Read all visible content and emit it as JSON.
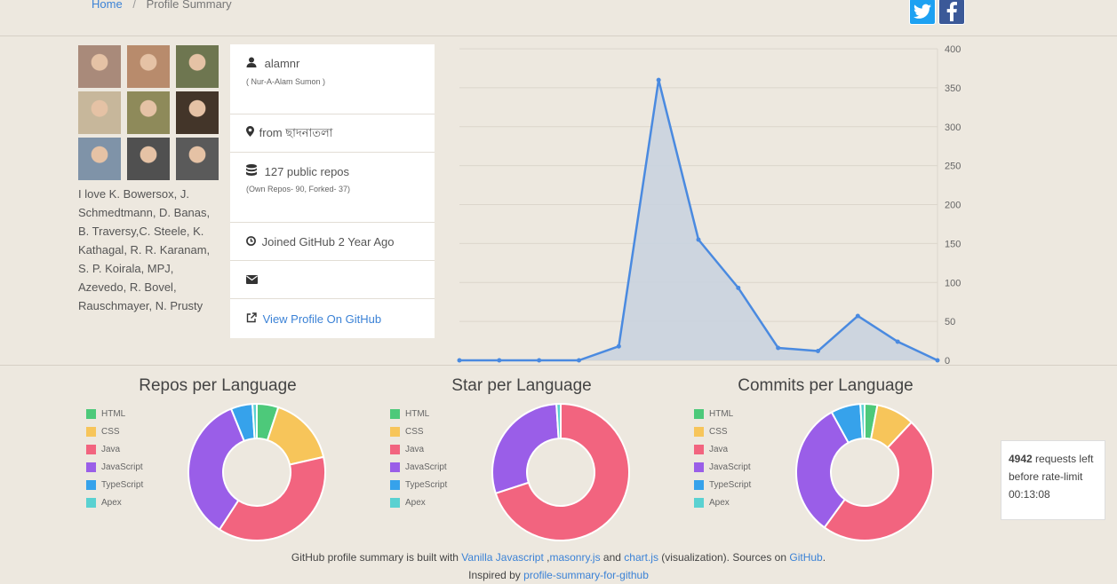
{
  "breadcrumb": {
    "home": "Home",
    "sep": "/",
    "current": "Profile Summary"
  },
  "social": {
    "twitter_glyph": "t",
    "facebook_glyph": "f",
    "twitter_color": "#1da1f2",
    "facebook_color": "#3b5998"
  },
  "avatars": [
    {
      "name": "avatar-1",
      "color": "#a98a7a"
    },
    {
      "name": "avatar-2",
      "color": "#b88b6c"
    },
    {
      "name": "avatar-3",
      "color": "#6e7650"
    },
    {
      "name": "avatar-4",
      "color": "#c7b79b"
    },
    {
      "name": "avatar-5",
      "color": "#8e8a5a"
    },
    {
      "name": "avatar-6",
      "color": "#433529"
    },
    {
      "name": "avatar-7",
      "color": "#7f93a8"
    },
    {
      "name": "avatar-8",
      "color": "#505050"
    },
    {
      "name": "avatar-9",
      "color": "#5a5a5a"
    }
  ],
  "love_text": "I love K. Bowersox, J. Schmedtmann, D. Banas, B. Traversy,C. Steele, K. Kathagal, R. R. Karanam, S. P. Koirala, MPJ, Azevedo, R. Bovel, Rauschmayer, N. Prusty",
  "profile": {
    "username": "alamnr",
    "fullname": "( Nur-A-Alam Sumon )",
    "location": "from ছাদনাতলা",
    "repos": "127 public repos",
    "repos_detail": "(Own Repos- 90, Forked- 37)",
    "joined": "Joined GitHub 2 Year Ago",
    "view_profile": "View Profile On GitHub"
  },
  "chart_data": [
    {
      "type": "area",
      "x": [
        1,
        2,
        3,
        4,
        5,
        6,
        7,
        8,
        9,
        10,
        11,
        12,
        13
      ],
      "values": [
        0,
        0,
        0,
        0,
        18,
        360,
        155,
        93,
        16,
        12,
        57,
        24,
        0
      ],
      "yticks": [
        "400",
        "350",
        "300",
        "250",
        "200",
        "150",
        "100",
        "50",
        "0"
      ],
      "ylim": [
        0,
        400
      ],
      "grid": true,
      "color": "#4a8ae0",
      "fill": "#c9d3df"
    },
    {
      "type": "pie",
      "title": "Repos per Language",
      "labels": [
        "HTML",
        "CSS",
        "Java",
        "JavaScript",
        "TypeScript",
        "Apex"
      ],
      "values": [
        5,
        16,
        37,
        34,
        5,
        1
      ],
      "colors": [
        "#4dc97a",
        "#f7c55a",
        "#f2647f",
        "#9a5ee8",
        "#36a2eb",
        "#5ad1d1"
      ]
    },
    {
      "type": "pie",
      "title": "Star per Language",
      "labels": [
        "HTML",
        "CSS",
        "Java",
        "JavaScript",
        "TypeScript",
        "Apex"
      ],
      "values": [
        0,
        0,
        70,
        29,
        0,
        1
      ],
      "colors": [
        "#4dc97a",
        "#f7c55a",
        "#f2647f",
        "#9a5ee8",
        "#36a2eb",
        "#5ad1d1"
      ]
    },
    {
      "type": "pie",
      "title": "Commits per Language",
      "labels": [
        "HTML",
        "CSS",
        "Java",
        "JavaScript",
        "TypeScript",
        "Apex"
      ],
      "values": [
        3,
        9,
        48,
        32,
        7,
        1
      ],
      "colors": [
        "#4dc97a",
        "#f7c55a",
        "#f2647f",
        "#9a5ee8",
        "#36a2eb",
        "#5ad1d1"
      ]
    }
  ],
  "rate": {
    "count": "4942",
    "line1": "requests left before rate-limit",
    "time": "00:13:08"
  },
  "footer": {
    "p1": "GitHub profile summary is built with ",
    "link1": "Vanilla Javascript",
    "comma": " ,",
    "link2": "masonry.js",
    "and": " and ",
    "link3": "chart.js",
    "p2": " (visualization). Sources on ",
    "link4": "GitHub",
    "dot": ".",
    "inspired": "Inspired by ",
    "link5": "profile-summary-for-github"
  }
}
